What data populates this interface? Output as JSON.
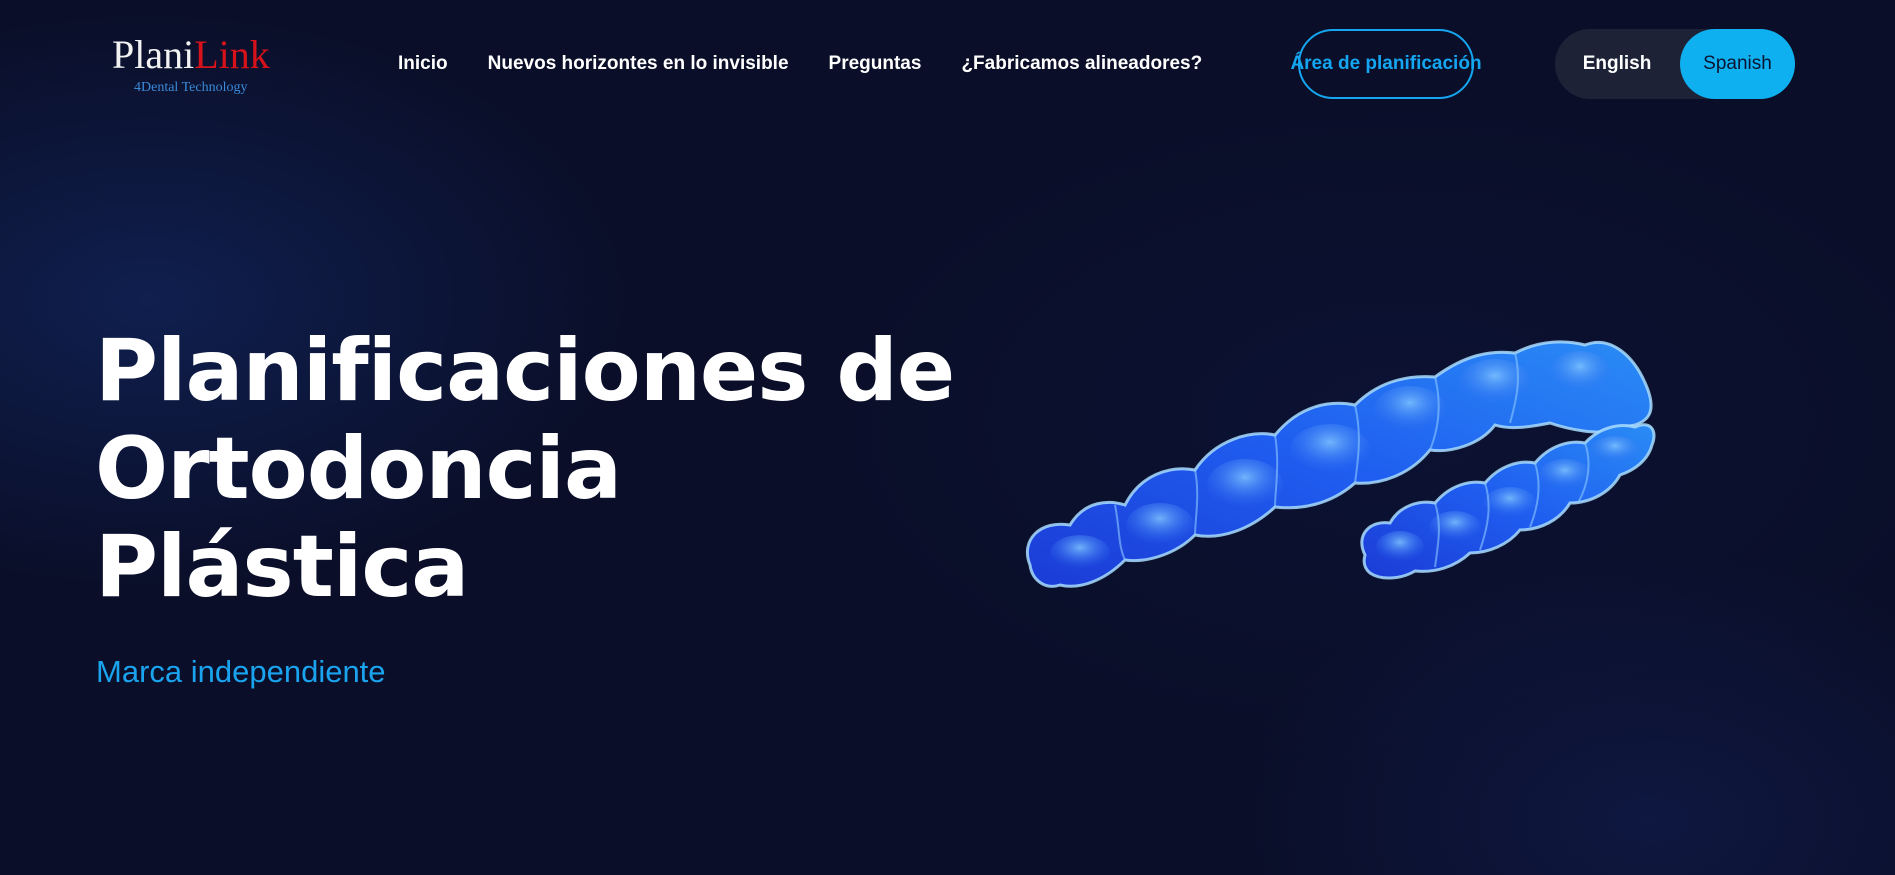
{
  "brand": {
    "name_part1": "Plani",
    "name_part2": "Link",
    "tagline": "4Dental Technology"
  },
  "nav": {
    "items": [
      {
        "label": "Inicio"
      },
      {
        "label": "Nuevos horizontes en lo invisible"
      },
      {
        "label": "Preguntas"
      },
      {
        "label": "¿Fabricamos alineadores?"
      }
    ]
  },
  "header": {
    "planning_button": "Área de planificación",
    "lang_english": "English",
    "lang_spanish": "Spanish",
    "lang_selected": "Spanish"
  },
  "hero": {
    "title_lines": [
      "Planificaciones de",
      "Ortodoncia",
      "Plástica"
    ],
    "subtitle": "Marca independiente",
    "image": "clear-aligner-image"
  },
  "colors": {
    "background": "#0a0e28",
    "accent": "#14a6f1",
    "logo_red": "#d8121b",
    "logo_blue": "#3b8ad8",
    "toggle_bg": "#1d2236",
    "toggle_active": "#0fb0f0"
  }
}
